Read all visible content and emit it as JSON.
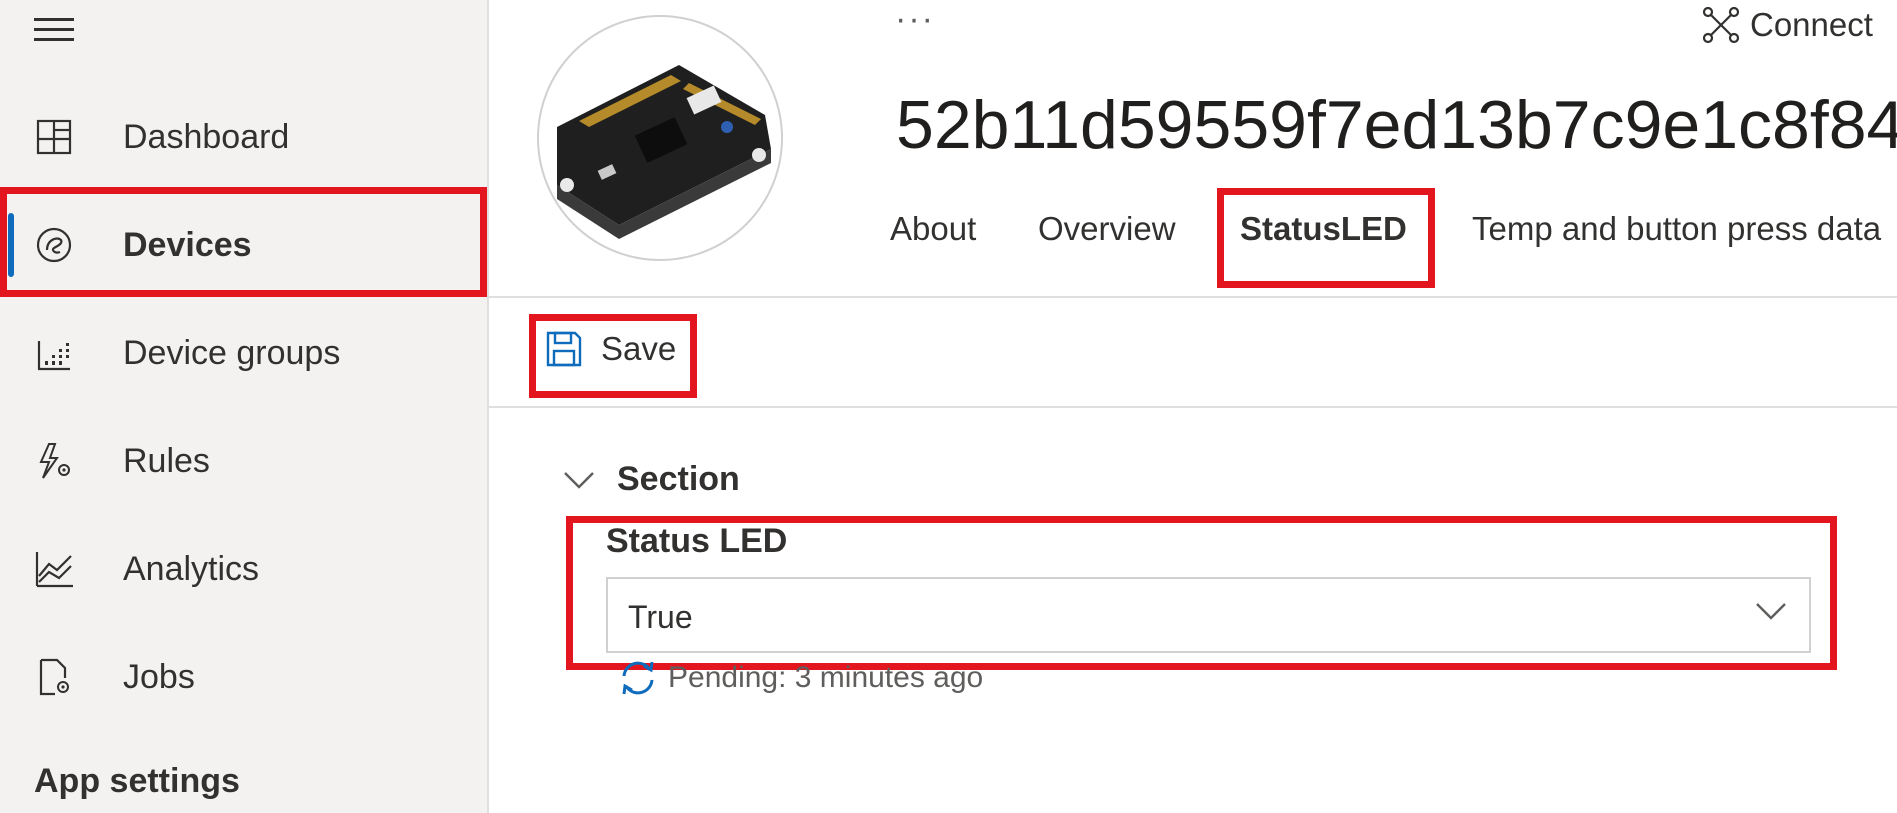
{
  "sidebar": {
    "items": [
      {
        "label": "Dashboard",
        "icon": "dashboard-icon"
      },
      {
        "label": "Devices",
        "icon": "devices-icon",
        "active": true
      },
      {
        "label": "Device groups",
        "icon": "device-groups-icon"
      },
      {
        "label": "Rules",
        "icon": "rules-icon"
      },
      {
        "label": "Analytics",
        "icon": "analytics-icon"
      },
      {
        "label": "Jobs",
        "icon": "jobs-icon"
      }
    ],
    "app_settings_label": "App settings"
  },
  "header": {
    "more_label": "···",
    "connect_label": "Connect",
    "device_title": "52b11d59559f7ed13b7c9e1c8f84",
    "tabs": [
      {
        "label": "About"
      },
      {
        "label": "Overview"
      },
      {
        "label": "StatusLED",
        "active": true
      },
      {
        "label": "Temp and button press data"
      }
    ]
  },
  "toolbar": {
    "save_label": "Save"
  },
  "form": {
    "section_label": "Section",
    "field_label": "Status LED",
    "field_value": "True",
    "pending_text": "Pending: 3 minutes ago"
  },
  "colors": {
    "accent": "#0f6cbd",
    "highlight": "#e3161f",
    "sidebar_bg": "#f3f2f1"
  }
}
